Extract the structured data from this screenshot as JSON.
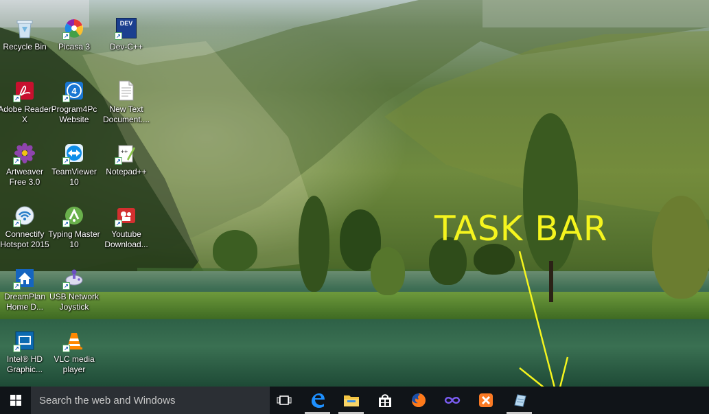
{
  "desktop": {
    "icons": [
      {
        "label": "Recycle Bin",
        "icon": "recycle-bin-icon"
      },
      {
        "label": "Picasa 3",
        "icon": "picasa-icon"
      },
      {
        "label": "Dev-C++",
        "icon": "dev-cpp-icon"
      },
      {
        "label": "Adobe Reader X",
        "icon": "adobe-reader-icon"
      },
      {
        "label": "Program4Pc Website",
        "icon": "program4pc-icon"
      },
      {
        "label": "New Text Document....",
        "icon": "text-document-icon"
      },
      {
        "label": "Artweaver Free 3.0",
        "icon": "artweaver-icon"
      },
      {
        "label": "TeamViewer 10",
        "icon": "teamviewer-icon"
      },
      {
        "label": "Notepad++",
        "icon": "notepad-plus-plus-icon"
      },
      {
        "label": "Connectify Hotspot 2015",
        "icon": "connectify-icon"
      },
      {
        "label": "Typing Master 10",
        "icon": "typing-master-icon"
      },
      {
        "label": "Youtube Download...",
        "icon": "youtube-downloader-icon"
      },
      {
        "label": "DreamPlan Home D...",
        "icon": "dreamplan-icon"
      },
      {
        "label": "USB Network Joystick",
        "icon": "usb-joystick-icon"
      },
      {
        "label": "Intel® HD Graphic...",
        "icon": "intel-graphics-icon"
      },
      {
        "label": "VLC media player",
        "icon": "vlc-icon"
      }
    ],
    "dev_badge": "DEV"
  },
  "annotation": {
    "text": "TASK BAR",
    "color": "#f5f51e"
  },
  "taskbar": {
    "search_placeholder": "Search the web and Windows",
    "pinned": [
      {
        "name": "task-view",
        "icon": "task-view-icon"
      },
      {
        "name": "edge",
        "icon": "edge-icon"
      },
      {
        "name": "file-explorer",
        "icon": "folder-icon"
      },
      {
        "name": "store",
        "icon": "store-icon"
      },
      {
        "name": "firefox",
        "icon": "firefox-icon"
      },
      {
        "name": "visual-studio",
        "icon": "infinity-icon"
      },
      {
        "name": "xampp",
        "icon": "xampp-icon"
      },
      {
        "name": "app",
        "icon": "app-icon"
      }
    ],
    "background": "#101418"
  }
}
